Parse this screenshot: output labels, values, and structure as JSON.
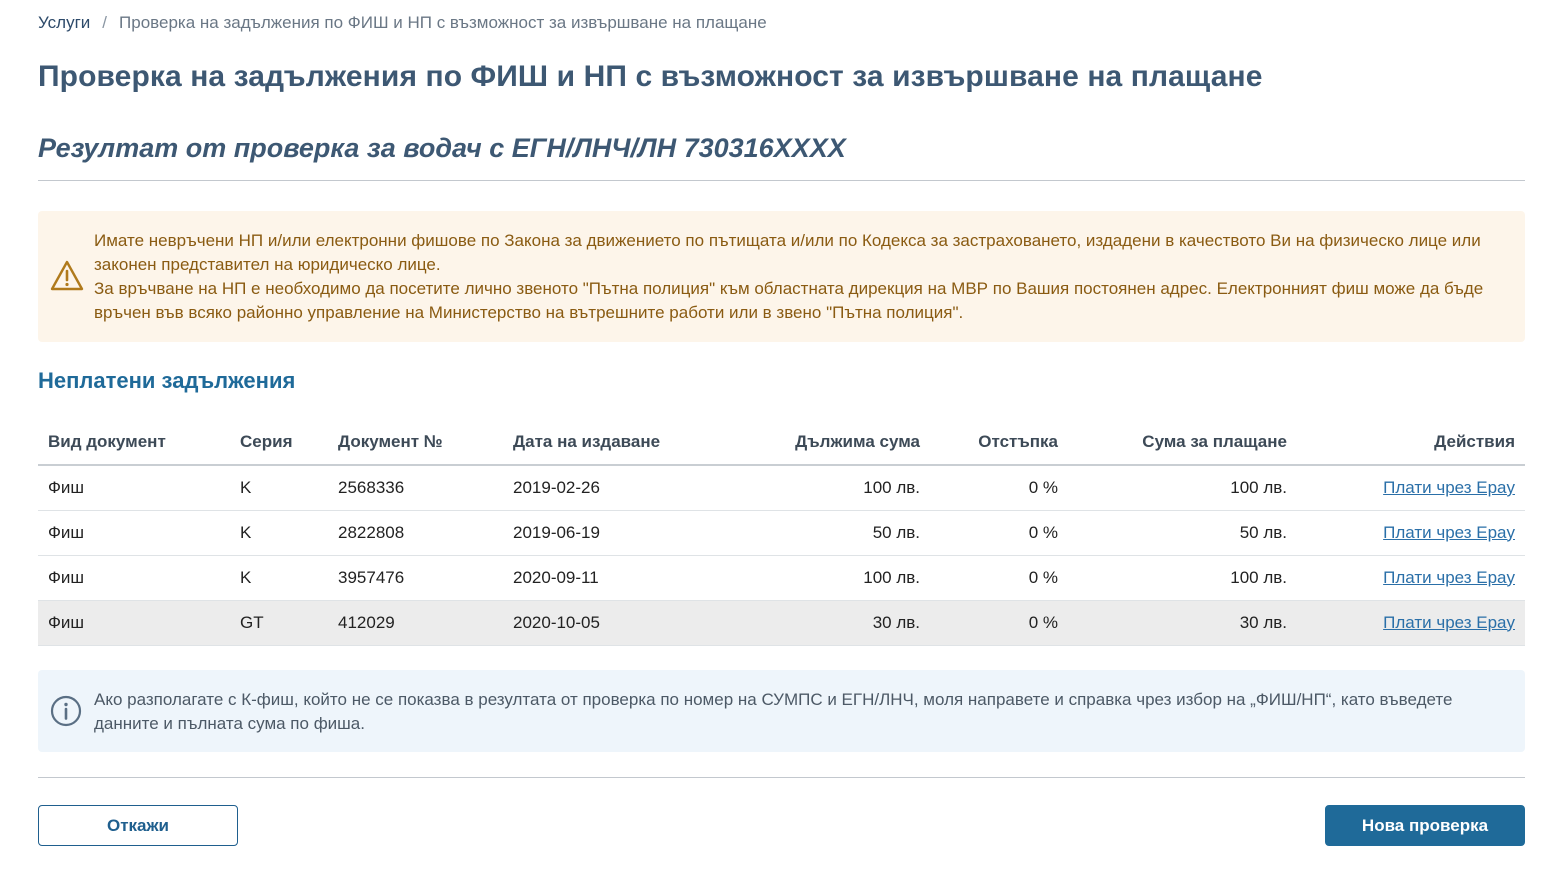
{
  "breadcrumb": {
    "services": "Услуги",
    "separator": "/",
    "current": "Проверка на задължения по ФИШ и НП с възможност за извършване на плащане"
  },
  "page_title": "Проверка на задължения по ФИШ и НП с възможност за извършване на плащане",
  "result_title": "Резултат от проверка за водач с ЕГН/ЛНЧ/ЛН 730316XXXX",
  "warning": {
    "icon": "warning-triangle-icon",
    "line1": "Имате невръчени НП и/или електронни фишове по Закона за движението по пътищата и/или по Кодекса за застраховането, издадени в качеството Ви на физическо лице или законен представител на юридическо лице.",
    "line2": "За връчване на НП е необходимо да посетите лично звеното \"Пътна полиция\" към областната дирекция на МВР по Вашия постоянен адрес. Електронният фиш може да бъде връчен във всяко районно управление на Министерство на вътрешните работи или в звено \"Пътна полиция\"."
  },
  "unpaid_section_title": "Неплатени задължения",
  "table": {
    "headers": {
      "doc_type": "Вид документ",
      "series": "Серия",
      "doc_no": "Документ №",
      "issue_date": "Дата на издаване",
      "amount_due": "Дължима сума",
      "discount": "Отстъпка",
      "amount_to_pay": "Сума за плащане",
      "actions": "Действия"
    },
    "rows": [
      {
        "doc_type": "Фиш",
        "series": "K",
        "doc_no": "2568336",
        "issue_date": "2019-02-26",
        "amount_due": "100 лв.",
        "discount": "0 %",
        "amount_to_pay": "100 лв.",
        "action": "Плати чрез Epay"
      },
      {
        "doc_type": "Фиш",
        "series": "K",
        "doc_no": "2822808",
        "issue_date": "2019-06-19",
        "amount_due": "50 лв.",
        "discount": "0 %",
        "amount_to_pay": "50 лв.",
        "action": "Плати чрез Epay"
      },
      {
        "doc_type": "Фиш",
        "series": "K",
        "doc_no": "3957476",
        "issue_date": "2020-09-11",
        "amount_due": "100 лв.",
        "discount": "0 %",
        "amount_to_pay": "100 лв.",
        "action": "Плати чрез Epay"
      },
      {
        "doc_type": "Фиш",
        "series": "GT",
        "doc_no": "412029",
        "issue_date": "2020-10-05",
        "amount_due": "30 лв.",
        "discount": "0 %",
        "amount_to_pay": "30 лв.",
        "action": "Плати чрез Epay"
      }
    ]
  },
  "info": {
    "icon": "info-circle-icon",
    "text": "Ако разполагате с К-фиш, който не се показва в резултата от проверка по номер на СУМПС и ЕГН/ЛНЧ, моля направете и справка чрез избор на „ФИШ/НП“, като въведете данните и пълната сума по фиша."
  },
  "buttons": {
    "cancel": "Откажи",
    "new_check": "Нова проверка"
  },
  "colors": {
    "title": "#3d5873",
    "section": "#1f6a99",
    "warning_bg": "#fdf5ea",
    "warning_text": "#8a5b12",
    "info_bg": "#eef5fb",
    "primary_button": "#1f6a99",
    "link": "#2a6fa8"
  }
}
